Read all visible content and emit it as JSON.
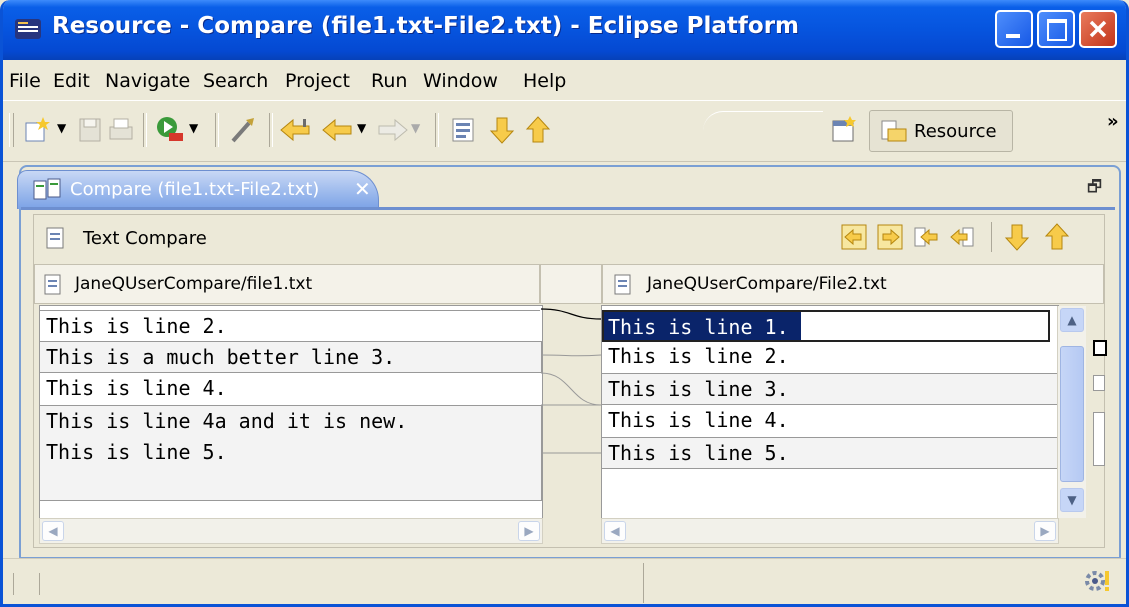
{
  "window": {
    "title": "Resource - Compare (file1.txt-File2.txt) - Eclipse Platform",
    "title_color": "#0654de"
  },
  "menubar": {
    "items": [
      "File",
      "Edit",
      "Navigate",
      "Search",
      "Project",
      "Run",
      "Window",
      "Help"
    ]
  },
  "toolbar": {
    "perspective_label": "Resource",
    "overflow_label": "»"
  },
  "editor": {
    "tab_label": "Compare (file1.txt-File2.txt)",
    "tab_close": "✕",
    "viewer_label": "Text Compare",
    "left": {
      "path": "JaneQUserCompare/file1.txt",
      "lines": [
        "This is line 2.",
        "This is a much better line 3.",
        "This is line 4.",
        "This is line 4a and it is new.",
        "This is line 5."
      ]
    },
    "right": {
      "path": "JaneQUserCompare/File2.txt",
      "lines": [
        "This is line 1.",
        "This is line 2.",
        "This is line 3.",
        "This is line 4.",
        "This is line 5."
      ]
    }
  },
  "colors": {
    "selection": "#0a246a",
    "view_border": "#7a9fd4",
    "toolbar_arrow": "#f0a010"
  }
}
